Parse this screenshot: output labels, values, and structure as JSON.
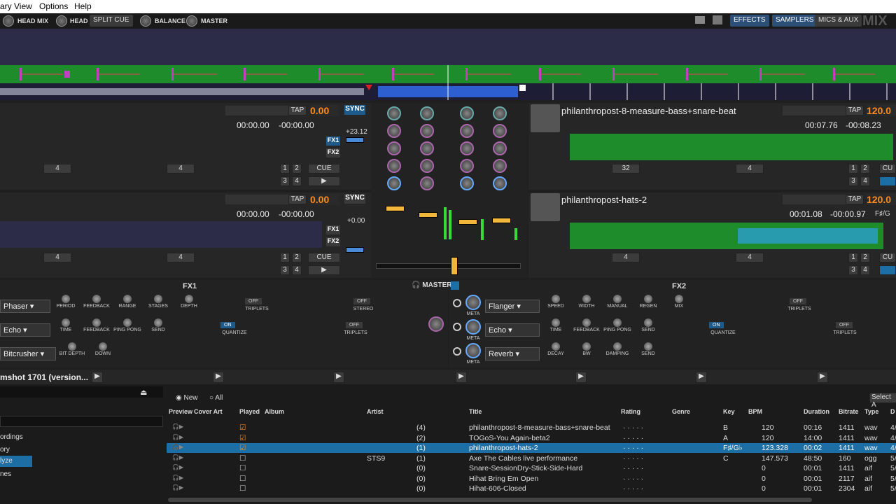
{
  "menu": [
    "ary",
    "View",
    "Options",
    "Help"
  ],
  "toolbar": {
    "head_mix": "HEAD MIX",
    "head": "HEAD",
    "split_cue": "SPLIT CUE",
    "balance": "BALANCE",
    "master": "MASTER",
    "effects": "EFFECTS",
    "samplers": "SAMPLERS",
    "mics_aux": "MICS & AUX",
    "logo": "MIX"
  },
  "deck1": {
    "rate": "0.00",
    "tap": "TAP",
    "time_elapsed": "00:00.00",
    "time_remaining": "-00:00.00",
    "sync": "SYNC",
    "pitch": "+23.12",
    "loop1": "4",
    "loop2": "4",
    "cue": "CUE",
    "hot1": "1",
    "hot2": "2",
    "hot3": "3",
    "hot4": "4",
    "fx1": "FX1",
    "fx2": "FX2"
  },
  "deck2": {
    "rate": "0.00",
    "tap": "TAP",
    "time_elapsed": "00:00.00",
    "time_remaining": "-00:00.00",
    "sync": "SYNC",
    "pitch": "+0.00",
    "loop1": "4",
    "loop2": "4",
    "cue": "CUE",
    "hot1": "1",
    "hot2": "2",
    "hot3": "3",
    "hot4": "4",
    "fx1": "FX1",
    "fx2": "FX2"
  },
  "deck3": {
    "title": "philanthropost-8-measure-bass+snare-beat",
    "rate": "120.0",
    "tap": "TAP",
    "time_elapsed": "00:07.76",
    "time_remaining": "-00:08.23",
    "loop1": "32",
    "loop2": "4",
    "hot1": "1",
    "hot2": "2",
    "hot3": "3",
    "hot4": "4",
    "cue": "CU"
  },
  "deck4": {
    "title": "philanthropost-hats-2",
    "rate": "120.0",
    "tap": "TAP",
    "time_elapsed": "00:01.08",
    "time_remaining": "-00:00.97",
    "key": "F♯/G",
    "loop1": "4",
    "loop2": "4",
    "hot1": "1",
    "hot2": "2",
    "hot3": "3",
    "hot4": "4",
    "cue": "CU"
  },
  "fx1": {
    "title": "FX1",
    "effects": [
      "Phaser",
      "Echo",
      "Bitcrusher"
    ],
    "phaser_params": [
      "PERIOD",
      "FEEDBACK",
      "RANGE",
      "STAGES",
      "DEPTH"
    ],
    "echo_params": [
      "TIME",
      "FEEDBACK",
      "PING PONG",
      "SEND"
    ],
    "bit_params": [
      "BIT DEPTH",
      "DOWN"
    ],
    "off": "OFF",
    "on": "ON",
    "triplets": "TRIPLETS",
    "stereo": "STEREO",
    "quantize": "QUANTIZE"
  },
  "fx2": {
    "title": "FX2",
    "effects": [
      "Flanger",
      "Echo",
      "Reverb"
    ],
    "flanger_params": [
      "SPEED",
      "WIDTH",
      "MANUAL",
      "REGEN",
      "MIX"
    ],
    "echo_params": [
      "TIME",
      "FEEDBACK",
      "PING PONG",
      "SEND"
    ],
    "reverb_params": [
      "DECAY",
      "BW",
      "DAMPING",
      "SEND"
    ],
    "meta": "META",
    "off": "OFF",
    "on": "ON",
    "triplets": "TRIPLETS",
    "quantize": "QUANTIZE"
  },
  "master_label": "MASTER",
  "library": {
    "crate_title": "mshot 1701 (version...",
    "new_label": "New",
    "all_label": "All",
    "select_all": "Select A",
    "sidebar": [
      "ordings",
      "ory",
      "lyze",
      "nes"
    ],
    "headers": [
      "Preview",
      "Cover Art",
      "Played",
      "Album",
      "Artist",
      "Title",
      "Rating",
      "Genre",
      "Key",
      "BPM",
      "Duration",
      "Bitrate",
      "Type",
      "D"
    ],
    "rows": [
      {
        "played": "(4)",
        "artist": "",
        "title": "philanthropost-8-measure-bass+snare-beat",
        "key": "B",
        "bpm": "120",
        "duration": "00:16",
        "bitrate": "1411",
        "type": "wav",
        "d": "4/"
      },
      {
        "played": "(2)",
        "artist": "",
        "title": "TOGoS-You Again-beta2",
        "key": "A",
        "bpm": "120",
        "duration": "14:00",
        "bitrate": "1411",
        "type": "wav",
        "d": "4/"
      },
      {
        "played": "(1)",
        "artist": "",
        "title": "philanthropost-hats-2",
        "key": "F♯/G♭",
        "bpm": "123.328",
        "duration": "00:02",
        "bitrate": "1411",
        "type": "wav",
        "d": "4/"
      },
      {
        "played": "(1)",
        "artist": "STS9",
        "title": "Axe The Cables live performance",
        "key": "C",
        "bpm": "147.573",
        "duration": "48:50",
        "bitrate": "160",
        "type": "ogg",
        "d": "5/"
      },
      {
        "played": "(0)",
        "artist": "",
        "title": "Snare-SessionDry-Stick-Side-Hard",
        "key": "",
        "bpm": "0",
        "duration": "00:01",
        "bitrate": "1411",
        "type": "aif",
        "d": "5/"
      },
      {
        "played": "(0)",
        "artist": "",
        "title": "Hihat Bring Em Open",
        "key": "",
        "bpm": "0",
        "duration": "00:01",
        "bitrate": "2117",
        "type": "aif",
        "d": "5/"
      },
      {
        "played": "(0)",
        "artist": "",
        "title": "Hihat-606-Closed",
        "key": "",
        "bpm": "0",
        "duration": "00:01",
        "bitrate": "2304",
        "type": "aif",
        "d": "5/"
      }
    ]
  }
}
